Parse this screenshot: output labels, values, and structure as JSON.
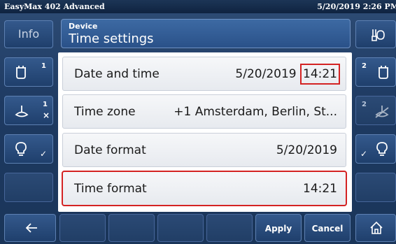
{
  "window": {
    "app_title": "EasyMax 402 Advanced",
    "datetime": "5/20/2019 2:26 PM"
  },
  "left_buttons": [
    {
      "icon": "info-icon",
      "label": "Info"
    },
    {
      "icon": "reactor-icon",
      "badge": "1"
    },
    {
      "icon": "stirrer-icon",
      "badge": "1",
      "sub": "×"
    },
    {
      "icon": "lightbulb-icon",
      "sub": "✓"
    }
  ],
  "right_buttons": [
    {
      "icon": "tools-icon"
    },
    {
      "icon": "reactor-icon",
      "badge": "2"
    },
    {
      "icon": "stirrer-icon",
      "badge": "2"
    },
    {
      "icon": "lightbulb-icon",
      "sub": "✓"
    }
  ],
  "header": {
    "section": "Device",
    "title": "Time settings"
  },
  "settings": [
    {
      "label": "Date and time",
      "value_date": "5/20/2019",
      "value_time": "14:21"
    },
    {
      "label": "Time zone",
      "value": "+1 Amsterdam, Berlin, St..."
    },
    {
      "label": "Date format",
      "value": "5/20/2019"
    },
    {
      "label": "Time format",
      "value": "14:21"
    }
  ],
  "footer": {
    "apply_label": "Apply",
    "cancel_label": "Cancel",
    "back_icon": "back-arrow-icon",
    "home_icon": "home-icon"
  },
  "colors": {
    "highlight": "#d42323",
    "title_bar": "#0f2340",
    "button": "#2a4d7f"
  }
}
